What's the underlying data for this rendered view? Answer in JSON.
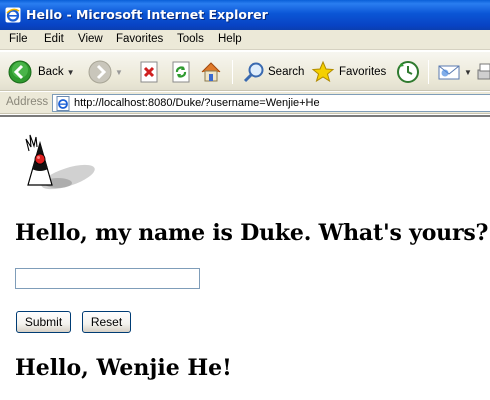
{
  "window": {
    "title": "Hello - Microsoft Internet Explorer",
    "icon": "ie-icon"
  },
  "menu": {
    "items": [
      "File",
      "Edit",
      "View",
      "Favorites",
      "Tools",
      "Help"
    ]
  },
  "toolbar": {
    "back_label": "Back",
    "search_label": "Search",
    "favorites_label": "Favorites"
  },
  "address": {
    "label": "Address",
    "url": "http://localhost:8080/Duke/?username=Wenjie+He"
  },
  "page": {
    "greeting_prompt": "Hello, my name is Duke. What's yours?",
    "name_input_value": "",
    "submit_label": "Submit",
    "reset_label": "Reset",
    "response": "Hello, Wenjie He!"
  }
}
